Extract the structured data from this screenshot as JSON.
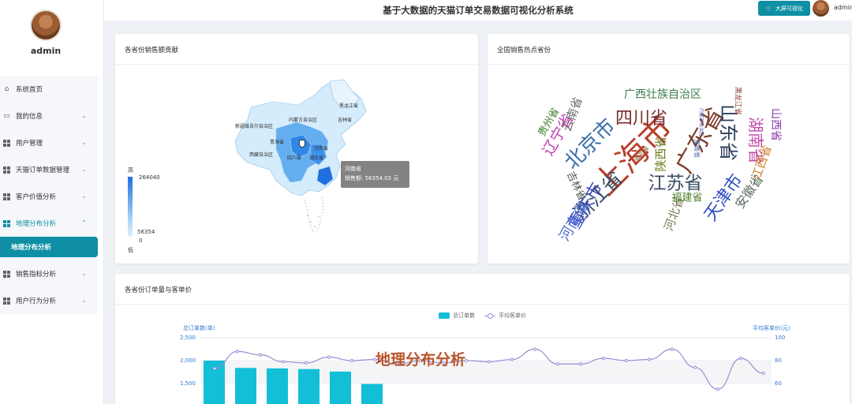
{
  "app": {
    "title": "基于大数据的天猫订单交易数据可视化分析系统"
  },
  "header": {
    "bigscreen_label": "大屏可视化",
    "username": "admin"
  },
  "sidebar": {
    "username": "admin",
    "items": [
      {
        "label": "系统首页",
        "icon": "home-icon"
      },
      {
        "label": "我的信息",
        "icon": "profile-icon"
      },
      {
        "label": "用户管理",
        "icon": "grid-icon"
      },
      {
        "label": "天猫订单数据管理",
        "icon": "grid-icon"
      },
      {
        "label": "客户价值分析",
        "icon": "grid-icon"
      },
      {
        "label": "地理分布分析",
        "icon": "grid-icon",
        "expanded": true
      },
      {
        "label": "销售指标分析",
        "icon": "grid-icon"
      },
      {
        "label": "用户行为分析",
        "icon": "grid-icon"
      }
    ],
    "active_sub": "地理分布分析"
  },
  "panels": {
    "map": {
      "title": "各省份销售额贡献",
      "legend_high": "高",
      "legend_low": "低",
      "legend_max": "264040",
      "legend_min_value": "56354",
      "legend_zero": "0",
      "tooltip_province": "河南省",
      "tooltip_value": "销售额: 56354.03 元",
      "province_labels": [
        "黑龙江省",
        "吉林省",
        "内蒙古自治区",
        "新疆维吾尔自治区",
        "西藏自治区",
        "青海省",
        "四川省",
        "湖北省",
        "河南省"
      ]
    },
    "cloud": {
      "title": "全国销售热点省份",
      "words": [
        {
          "text": "上海市",
          "color": "#b83d2a"
        },
        {
          "text": "广东省",
          "color": "#7a3b2a"
        },
        {
          "text": "北京市",
          "color": "#3a6fa8"
        },
        {
          "text": "四川省",
          "color": "#7a2a2a"
        },
        {
          "text": "山东省",
          "color": "#2b3f5c"
        },
        {
          "text": "江苏省",
          "color": "#3a4d63"
        },
        {
          "text": "浙江省",
          "color": "#3a4d63"
        },
        {
          "text": "湖南省",
          "color": "#c24ba8"
        },
        {
          "text": "天津市",
          "color": "#2f4cc2"
        },
        {
          "text": "重庆市",
          "color": "#3b4bc2"
        },
        {
          "text": "河南省",
          "color": "#4b6fd1"
        },
        {
          "text": "辽宁省",
          "color": "#c23bb0"
        },
        {
          "text": "陕西省",
          "color": "#6b7d1c"
        },
        {
          "text": "广西壮族自治区",
          "color": "#3f7d4c"
        },
        {
          "text": "河北省",
          "color": "#7a7d52"
        },
        {
          "text": "安徽省",
          "color": "#5a6b60"
        },
        {
          "text": "福建省",
          "color": "#4d7d2a"
        },
        {
          "text": "云南省",
          "color": "#6b6b6b"
        },
        {
          "text": "江西省",
          "color": "#d17d2a"
        },
        {
          "text": "山西省",
          "color": "#8a3ba8"
        },
        {
          "text": "吉林省",
          "color": "#4d5a4d"
        },
        {
          "text": "贵州省",
          "color": "#3f7d2a"
        },
        {
          "text": "湖北省",
          "color": "#7a5a2a"
        },
        {
          "text": "黑龙江省",
          "color": "#8a3b3b"
        },
        {
          "text": "海南省",
          "color": "#3b5aa8"
        },
        {
          "text": "内蒙古自治区",
          "color": "#5a5aa8"
        }
      ]
    },
    "bars": {
      "title": "各省份订单量与客单价",
      "watermark": "地理分布分析"
    }
  },
  "chart_data": {
    "type": "bar",
    "title": "",
    "legend": [
      "总订单数",
      "平均客单价"
    ],
    "legend_position": "top-center",
    "ylabel_left": "总订单数(单)",
    "ylabel_right": "平均客单价(元)",
    "yticks_left": [
      "2,500",
      "2,000",
      "1,500"
    ],
    "yticks_right": [
      "100",
      "80",
      "60"
    ],
    "ylim_left": [
      1500,
      2500
    ],
    "ylim_right": [
      60,
      100
    ],
    "series": [
      {
        "name": "总订单数",
        "type": "bar",
        "color": "#12bfd7",
        "values": [
          2000,
          1840,
          1830,
          1815,
          1760,
          1490
        ]
      },
      {
        "name": "平均客单价",
        "type": "line",
        "color": "#9b8bd6",
        "values": [
          73,
          88,
          85,
          79,
          78,
          83,
          80,
          81,
          77,
          80,
          78,
          80,
          79,
          81,
          90,
          77,
          77,
          82,
          80,
          81,
          90,
          74,
          55,
          82,
          69
        ]
      }
    ]
  }
}
